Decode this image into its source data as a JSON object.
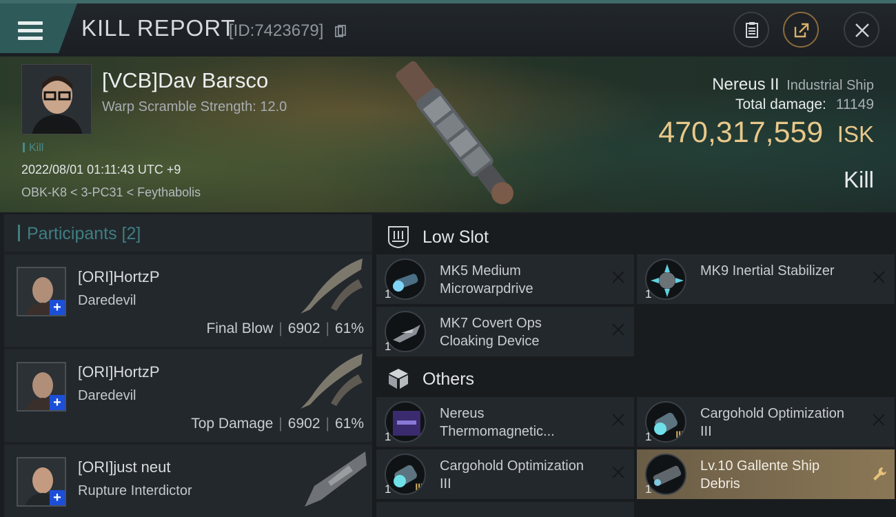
{
  "header": {
    "title": "KILL REPORT",
    "report_id": "[ID:7423679]"
  },
  "victim": {
    "name": "[VCB]Dav Barsco",
    "scramble": "Warp Scramble Strength: 12.0",
    "tag": "Kill",
    "datetime": "2022/08/01 01:11:43 UTC +9",
    "location": "OBK-K8 < 3-PC31 < Feythabolis",
    "ship_name": "Nereus II",
    "ship_class": "Industrial Ship",
    "total_damage_label": "Total damage:",
    "total_damage": "11149",
    "isk_value": "470,317,559",
    "isk_unit": "ISK",
    "result": "Kill"
  },
  "participants": {
    "title": "Participants [2]",
    "rows": [
      {
        "name": "[ORI]HortzP",
        "ship": "Daredevil",
        "role": "Final Blow",
        "damage": "6902",
        "percent": "61%"
      },
      {
        "name": "[ORI]HortzP",
        "ship": "Daredevil",
        "role": "Top Damage",
        "damage": "6902",
        "percent": "61%"
      },
      {
        "name": "[ORI]just neut",
        "ship": "Rupture Interdictor"
      }
    ]
  },
  "sections": {
    "low_slot": "Low Slot",
    "others": "Others"
  },
  "items": {
    "low": [
      {
        "qty": "1",
        "name": "MK5 Medium Microwarpdrive"
      },
      {
        "qty": "1",
        "name": "MK9 Inertial Stabilizer"
      },
      {
        "qty": "1",
        "name": "MK7 Covert Ops Cloaking Device"
      }
    ],
    "others": [
      {
        "qty": "1",
        "name": "Nereus Thermomagnetic..."
      },
      {
        "qty": "1",
        "name": "Cargohold Optimization III"
      },
      {
        "qty": "1",
        "name": "Cargohold Optimization III"
      },
      {
        "qty": "1",
        "name": "Lv.10 Gallente Ship Debris"
      }
    ]
  },
  "colors": {
    "accent_teal": "#3f7f82",
    "isk_gold": "#e8c88a",
    "badge_blue": "#1c4fd8"
  }
}
